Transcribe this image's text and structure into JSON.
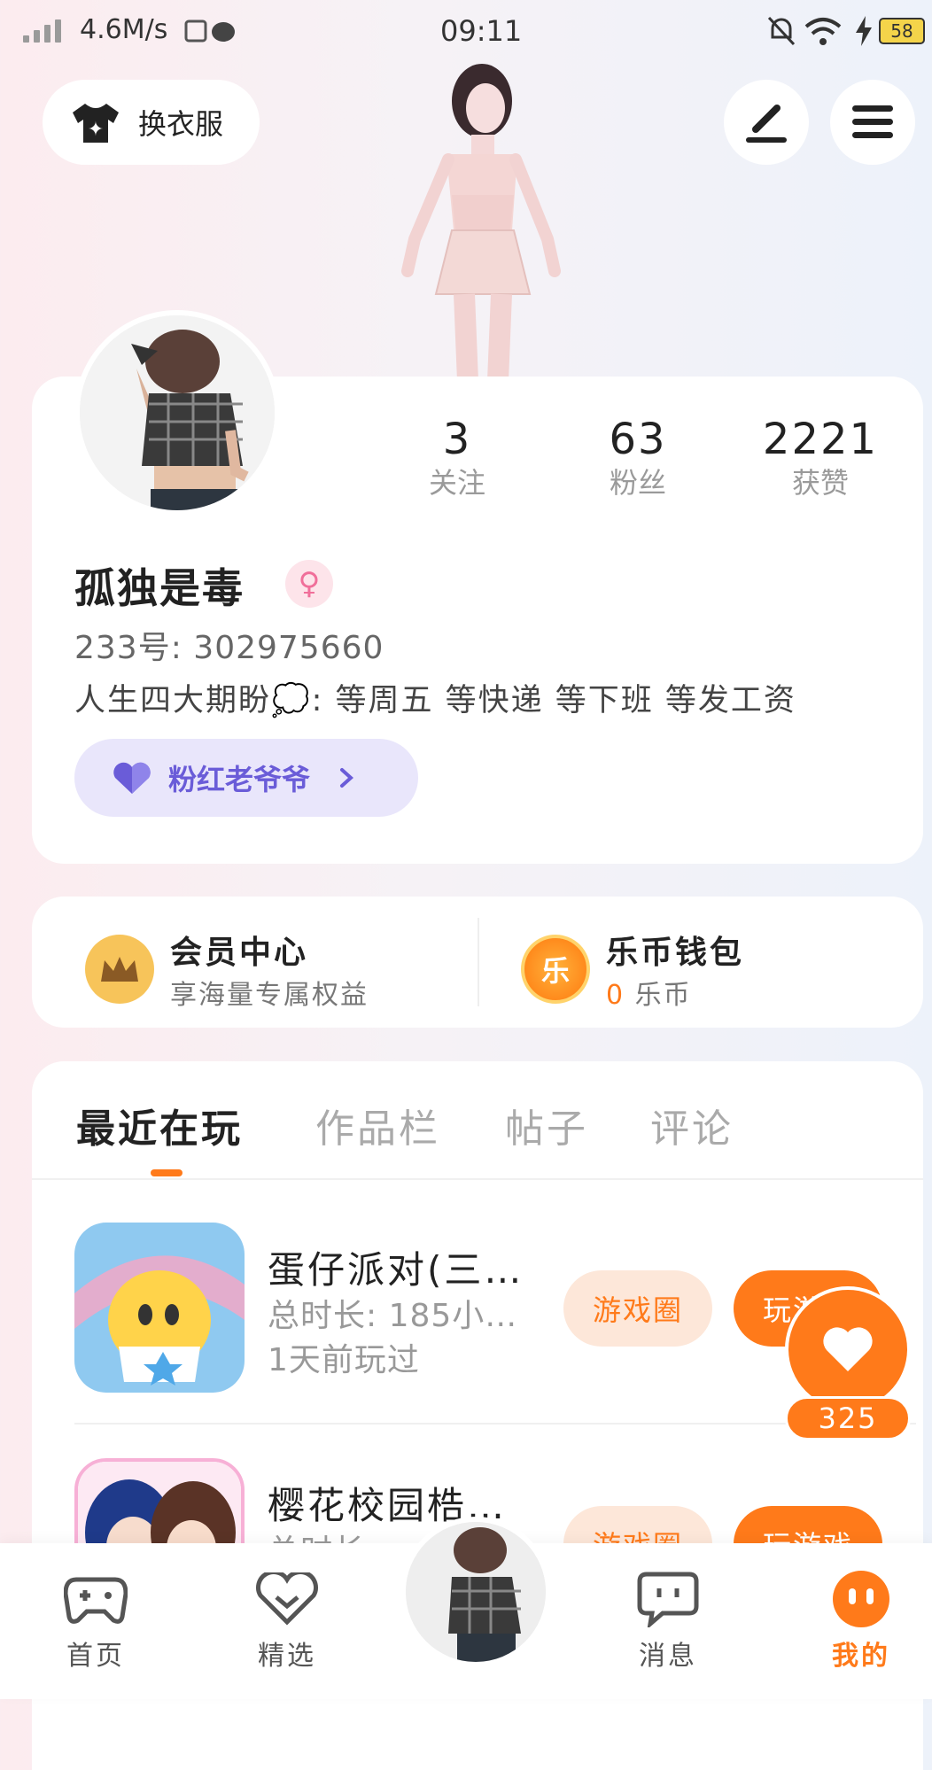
{
  "status": {
    "speed": "4.6M/s",
    "time": "09:11",
    "battery": "58"
  },
  "top": {
    "outfit_label": "换衣服"
  },
  "profile": {
    "stats": [
      {
        "value": "3",
        "label": "关注"
      },
      {
        "value": "63",
        "label": "粉丝"
      },
      {
        "value": "2221",
        "label": "获赞"
      }
    ],
    "name": "孤独是毒",
    "gender_symbol": "♀",
    "uid": "233号: 302975660",
    "bio": "人生四大期盼💭: 等周五 等快递 等下班 等发工资",
    "badge": "粉红老爷爷"
  },
  "vip": {
    "member_title": "会员中心",
    "member_sub": "享海量专属权益",
    "wallet_title": "乐币钱包",
    "wallet_amount": "0",
    "wallet_unit": "乐币",
    "wallet_icon_text": "乐"
  },
  "tabs": [
    "最近在玩",
    "作品栏",
    "帖子",
    "评论"
  ],
  "games": [
    {
      "title": "蛋仔派对(三…",
      "duration": "总时长: 185小…",
      "last": "1天前玩过",
      "circle": "游戏圈",
      "play": "玩游戏"
    },
    {
      "title": "樱花校园梏…",
      "duration": "总时长:",
      "circle": "游戏圈",
      "play": "玩游戏"
    }
  ],
  "float": {
    "count": "325"
  },
  "nav": [
    {
      "label": "首页"
    },
    {
      "label": "精选"
    },
    {
      "label": "消息"
    },
    {
      "label": "我的"
    }
  ]
}
